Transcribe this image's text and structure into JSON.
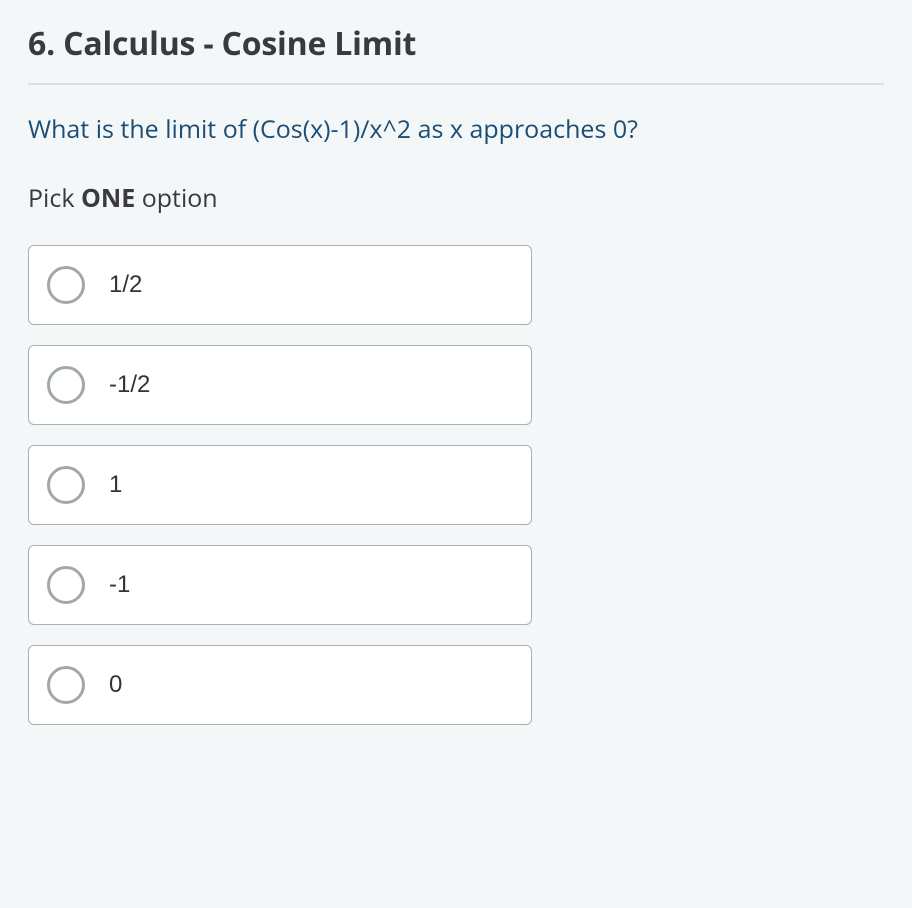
{
  "question": {
    "number": "6.",
    "title": "Calculus - Cosine Limit",
    "text": "What is the limit of (Cos(x)-1)/x^2 as x approaches 0?",
    "instruction_prefix": "Pick ",
    "instruction_bold": "ONE",
    "instruction_suffix": " option"
  },
  "options": [
    {
      "label": "1/2"
    },
    {
      "label": "-1/2"
    },
    {
      "label": "1"
    },
    {
      "label": "-1"
    },
    {
      "label": "0"
    }
  ]
}
